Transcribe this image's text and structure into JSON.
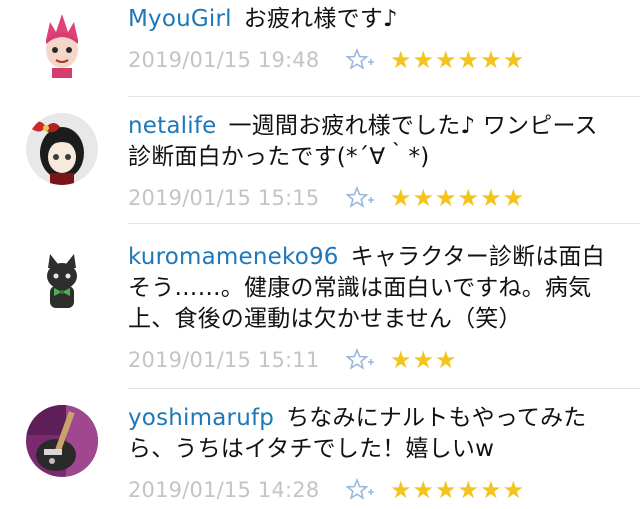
{
  "comments": [
    {
      "user": "MyouGirl",
      "text": "お疲れ様です♪",
      "time": "2019/01/15 19:48",
      "star_count": 6,
      "avatar": "pink-hair-character"
    },
    {
      "user": "netalife",
      "text": "一週間お疲れ様でした♪ ワンピース診断面白かったです(*´∀｀*)",
      "time": "2019/01/15 15:15",
      "star_count": 6,
      "avatar": "anime-girl-red-bow"
    },
    {
      "user": "kuromameneko96",
      "text": "キャラクター診断は面白そう……。健康の常識は面白いですね。病気上、食後の運動は欠かせません（笑）",
      "time": "2019/01/15 15:11",
      "star_count": 3,
      "avatar": "black-cat-green-bow"
    },
    {
      "user": "yoshimarufp",
      "text": "ちなみにナルトもやってみたら、うちはイタチでした！嬉しいw",
      "time": "2019/01/15 14:28",
      "star_count": 6,
      "avatar": "guitar-photo"
    }
  ],
  "colors": {
    "username": "#1d77b8",
    "timestamp": "#c4c4c4",
    "star": "#f3c31e",
    "add_star": "#9bb8db"
  },
  "icons": {
    "add_star": "star-plus-icon",
    "star": "star-icon"
  }
}
